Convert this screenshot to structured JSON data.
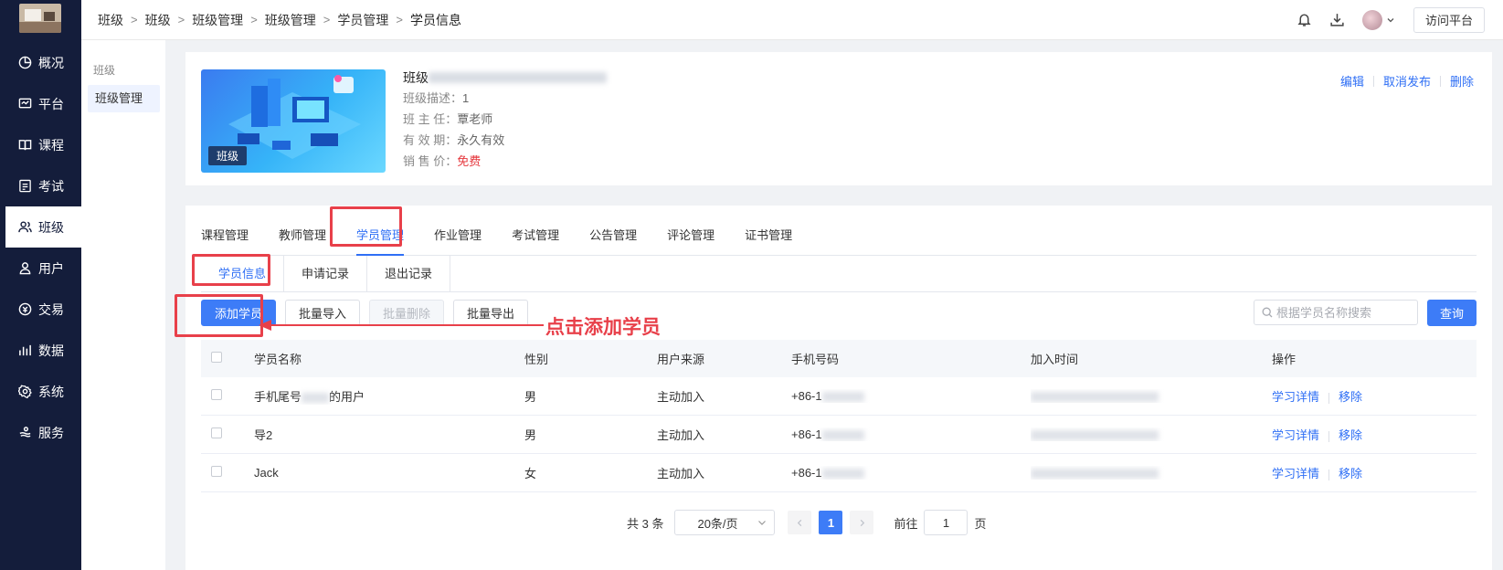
{
  "sidebar": {
    "items": [
      {
        "label": "概况",
        "icon": "pie-chart-icon"
      },
      {
        "label": "平台",
        "icon": "monitor-icon"
      },
      {
        "label": "课程",
        "icon": "book-icon"
      },
      {
        "label": "考试",
        "icon": "exam-icon"
      },
      {
        "label": "班级",
        "icon": "users-icon",
        "active": true
      },
      {
        "label": "用户",
        "icon": "user-icon"
      },
      {
        "label": "交易",
        "icon": "exchange-icon"
      },
      {
        "label": "数据",
        "icon": "bar-chart-icon"
      },
      {
        "label": "系统",
        "icon": "gear-icon"
      },
      {
        "label": "服务",
        "icon": "service-icon"
      }
    ]
  },
  "topbar": {
    "breadcrumb": [
      "班级",
      "班级",
      "班级管理",
      "班级管理",
      "学员管理",
      "学员信息"
    ],
    "visit_label": "访问平台"
  },
  "subnav": {
    "group_label": "班级",
    "item_label": "班级管理"
  },
  "class_info": {
    "title_prefix": "班级",
    "cover_badge": "班级",
    "desc_label": "班级描述：",
    "desc_value": "1",
    "teacher_label": "班 主 任：",
    "teacher_value": "覃老师",
    "validity_label": "有 效 期：",
    "validity_value": "永久有效",
    "price_label": "销 售 价：",
    "price_value": "免费",
    "price_color": "#e5363c",
    "actions": {
      "edit": "编辑",
      "unpublish": "取消发布",
      "delete": "删除"
    }
  },
  "tabs": [
    "课程管理",
    "教师管理",
    "学员管理",
    "作业管理",
    "考试管理",
    "公告管理",
    "评论管理",
    "证书管理"
  ],
  "active_tab": 2,
  "subtabs": [
    "学员信息",
    "申请记录",
    "退出记录"
  ],
  "toolbar": {
    "add_label": "添加学员",
    "import_label": "批量导入",
    "batch_delete_label": "批量删除",
    "export_label": "批量导出",
    "search_placeholder": "根据学员名称搜索",
    "query_label": "查询"
  },
  "table": {
    "headers": {
      "name": "学员名称",
      "gender": "性别",
      "source": "用户来源",
      "phone": "手机号码",
      "join_time": "加入时间",
      "ops": "操作"
    },
    "rows": [
      {
        "name_prefix": "手机尾号",
        "name_suffix": "的用户",
        "gender": "男",
        "source": "主动加入",
        "phone_prefix": "+86-1"
      },
      {
        "name_prefix": "导2",
        "name_suffix": "",
        "gender": "男",
        "source": "主动加入",
        "phone_prefix": "+86-1"
      },
      {
        "name_prefix": "Jack",
        "name_suffix": "",
        "gender": "女",
        "source": "主动加入",
        "phone_prefix": "+86-1"
      }
    ],
    "op_detail": "学习详情",
    "op_remove": "移除"
  },
  "pagination": {
    "total_text": "共 3 条",
    "page_size": "20条/页",
    "current_page": "1",
    "goto_label": "前往",
    "goto_value": "1",
    "goto_suffix": "页"
  },
  "annotation": {
    "text": "点击添加学员",
    "color": "#e8404a"
  },
  "colors": {
    "primary": "#3d7cf7",
    "sidebar_bg": "#141d3b",
    "link": "#2f6ff5"
  }
}
